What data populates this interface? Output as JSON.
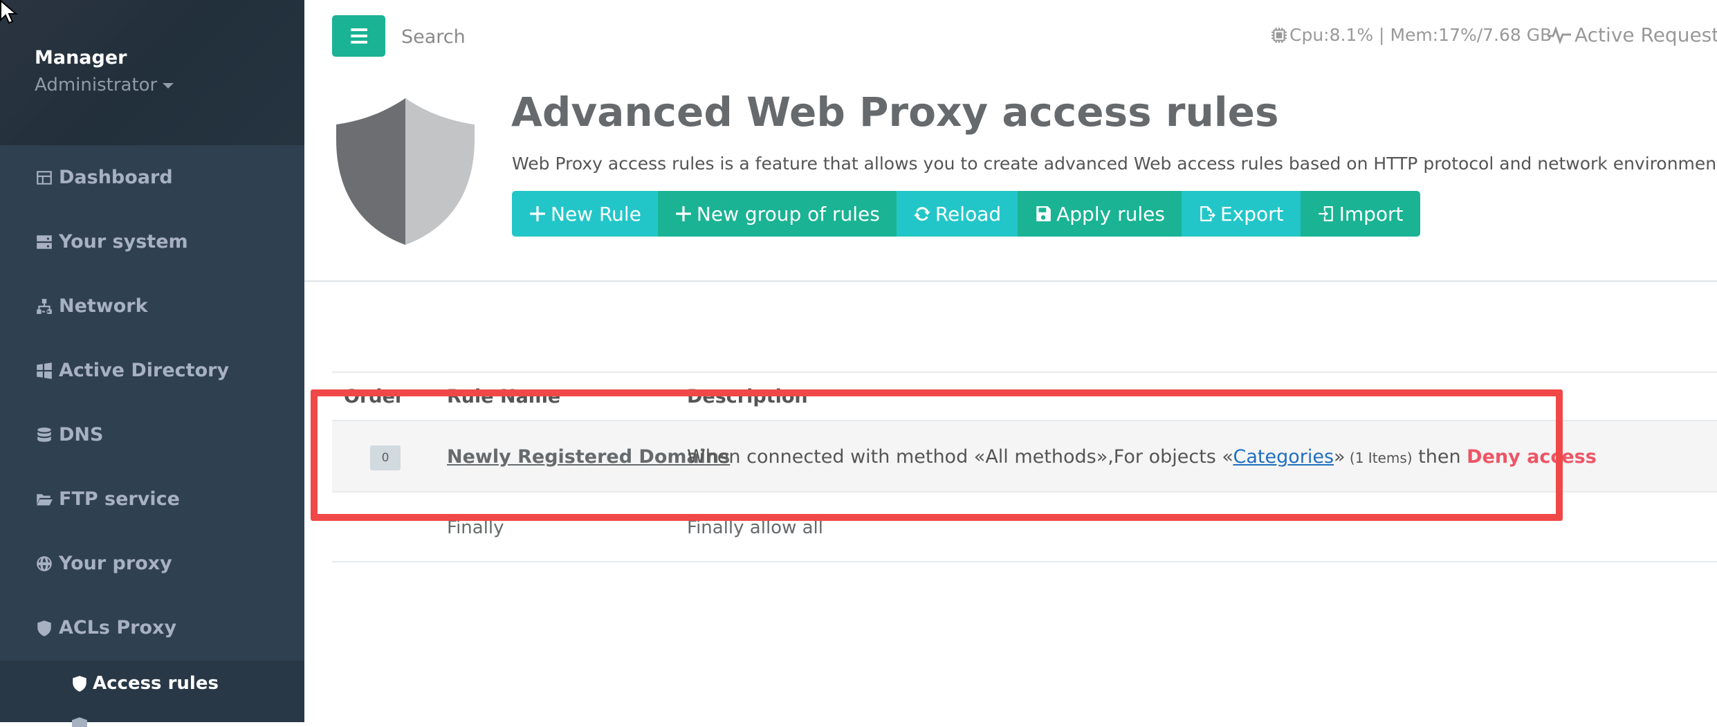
{
  "sidebar": {
    "user_name": "Manager",
    "user_role": "Administrator",
    "items": [
      {
        "label": "Dashboard",
        "icon": "dashboard-icon"
      },
      {
        "label": "Your system",
        "icon": "server-icon"
      },
      {
        "label": "Network",
        "icon": "network-icon"
      },
      {
        "label": "Active Directory",
        "icon": "windows-icon"
      },
      {
        "label": "DNS",
        "icon": "database-icon"
      },
      {
        "label": "FTP service",
        "icon": "folder-open-icon"
      },
      {
        "label": "Your proxy",
        "icon": "globe-icon"
      },
      {
        "label": "ACLs Proxy",
        "icon": "shield-icon"
      }
    ],
    "sub_items": [
      {
        "label": "Access rules",
        "icon": "shield-icon"
      }
    ]
  },
  "topbar": {
    "search_placeholder": "Search",
    "cpu": "Cpu:8.1%",
    "mem": "Mem:17%/7.68 GB",
    "active_requests": "Active Requests"
  },
  "header": {
    "title": "Advanced Web Proxy access rules",
    "description": "Web Proxy access rules is a feature that allows you to create advanced Web access rules based on HTTP protocol and network environments",
    "buttons": [
      {
        "label": "New Rule",
        "icon": "plus-icon",
        "color": "#23c6c8"
      },
      {
        "label": "New group of rules",
        "icon": "plus-icon",
        "color": "#1ab394"
      },
      {
        "label": "Reload",
        "icon": "refresh-icon",
        "color": "#23c6c8"
      },
      {
        "label": "Apply rules",
        "icon": "save-icon",
        "color": "#1ab394"
      },
      {
        "label": "Export",
        "icon": "export-icon",
        "color": "#23c6c8"
      },
      {
        "label": "Import",
        "icon": "import-icon",
        "color": "#1ab394"
      }
    ]
  },
  "table": {
    "columns": [
      "Order",
      "Rule Name",
      "Description"
    ],
    "rows": [
      {
        "order": "0",
        "name": "Newly Registered Domains",
        "desc_prefix": "When connected with method «All methods»,For objects «",
        "desc_link": "Categories",
        "desc_mid": "»",
        "desc_count": " (1 Items)",
        "desc_then": " then ",
        "desc_action": "Deny access"
      }
    ],
    "final_row": {
      "name": "Finally",
      "description": "Finally allow all"
    }
  },
  "colors": {
    "sidebar_bg": "#2f4050",
    "accent_green": "#1ab394",
    "accent_cyan": "#23c6c8",
    "deny_red": "#ed5565",
    "highlight_red": "#f04848"
  }
}
